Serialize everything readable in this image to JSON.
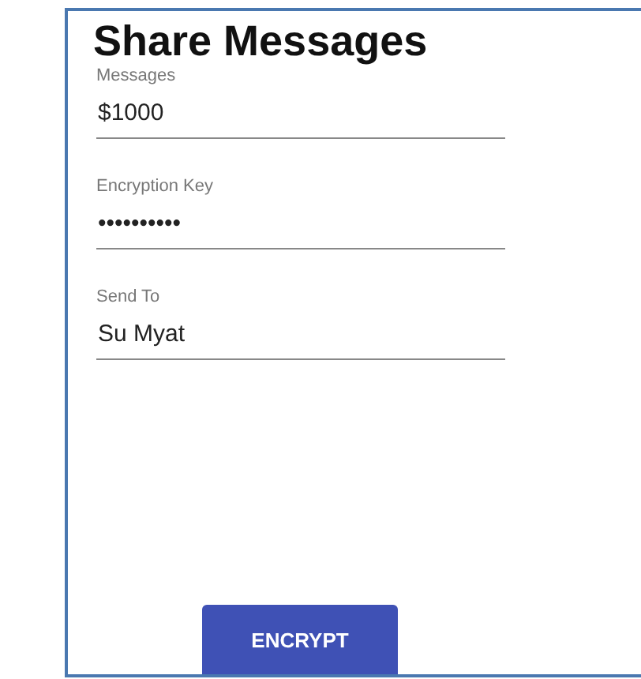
{
  "title": "Share Messages",
  "fields": [
    {
      "label": "Messages",
      "value": "$1000"
    },
    {
      "label": "Encryption Key",
      "value": "••••••••••"
    },
    {
      "label": "Send To",
      "value": "Su Myat"
    }
  ],
  "button": "ENCRYPT"
}
